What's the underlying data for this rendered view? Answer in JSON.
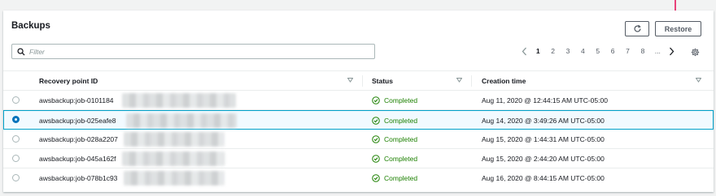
{
  "panel": {
    "title": "Backups",
    "refresh_icon": "refresh-icon",
    "restore_label": "Restore"
  },
  "filter": {
    "placeholder": "Filter",
    "icon": "search-icon"
  },
  "pagination": {
    "pages": [
      "1",
      "2",
      "3",
      "4",
      "5",
      "6",
      "7",
      "8",
      "..."
    ],
    "active_page": "1",
    "prev_icon": "chevron-left-icon",
    "next_icon": "chevron-right-icon",
    "settings_icon": "gear-icon"
  },
  "table": {
    "columns": [
      "Recovery point ID",
      "Status",
      "Creation time"
    ],
    "rows": [
      {
        "id": "awsbackup:job-0101184",
        "status": "Completed",
        "created": "Aug 11, 2020 @ 12:44:15 AM UTC-05:00",
        "selected": false
      },
      {
        "id": "awsbackup:job-025eafe8",
        "status": "Completed",
        "created": "Aug 14, 2020 @ 3:49:26 AM UTC-05:00",
        "selected": true
      },
      {
        "id": "awsbackup:job-028a2207",
        "status": "Completed",
        "created": "Aug 15, 2020 @ 1:44:31 AM UTC-05:00",
        "selected": false
      },
      {
        "id": "awsbackup:job-045a162f",
        "status": "Completed",
        "created": "Aug 15, 2020 @ 2:44:20 AM UTC-05:00",
        "selected": false
      },
      {
        "id": "awsbackup:job-078b1c93",
        "status": "Completed",
        "created": "Aug 16, 2020 @ 8:44:15 AM UTC-05:00",
        "selected": false
      }
    ]
  },
  "colors": {
    "accent": "#0073bb",
    "success": "#1d8102",
    "annotation_arrow": "#e8437a"
  }
}
